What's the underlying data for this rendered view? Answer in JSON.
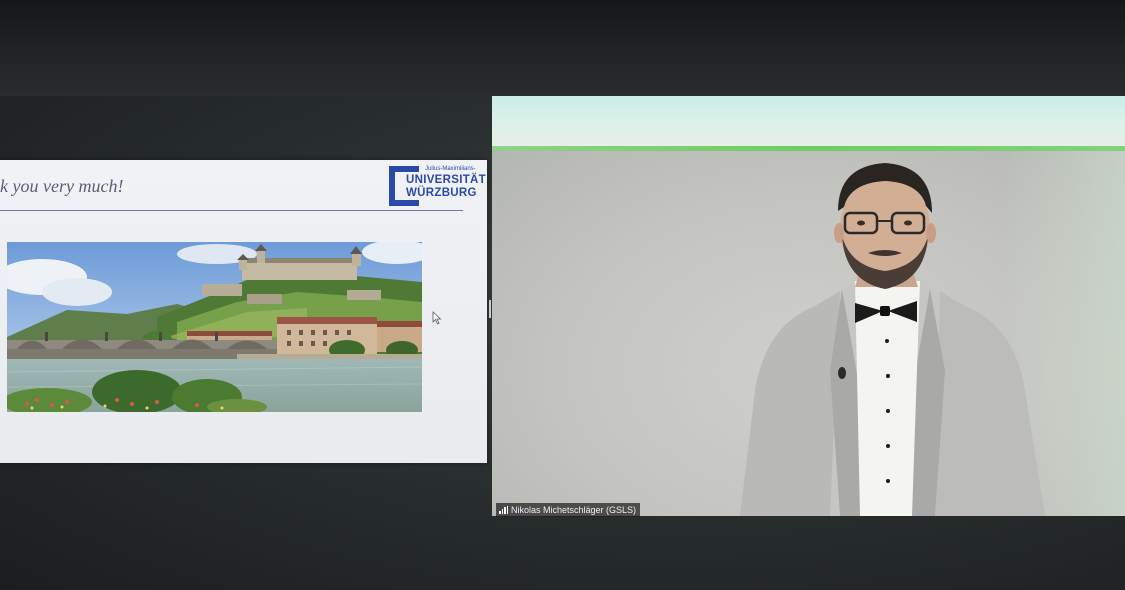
{
  "shared_slide": {
    "title": "k you very much!",
    "logo": {
      "top_text": "Julius-Maximilians-",
      "line1": "UNIVERSITÄT",
      "line2": "WÜRZBURG",
      "color": "#2b4aa8"
    },
    "photo": "wurzburg-fortress-and-bridge-photo"
  },
  "video": {
    "participant_name": "Nikolas Michetschläger (GSLS)",
    "signal_icon": "connection-strength-icon"
  },
  "colors": {
    "slide_title": "#5b5c78",
    "accent_green": "#6fcc61"
  }
}
